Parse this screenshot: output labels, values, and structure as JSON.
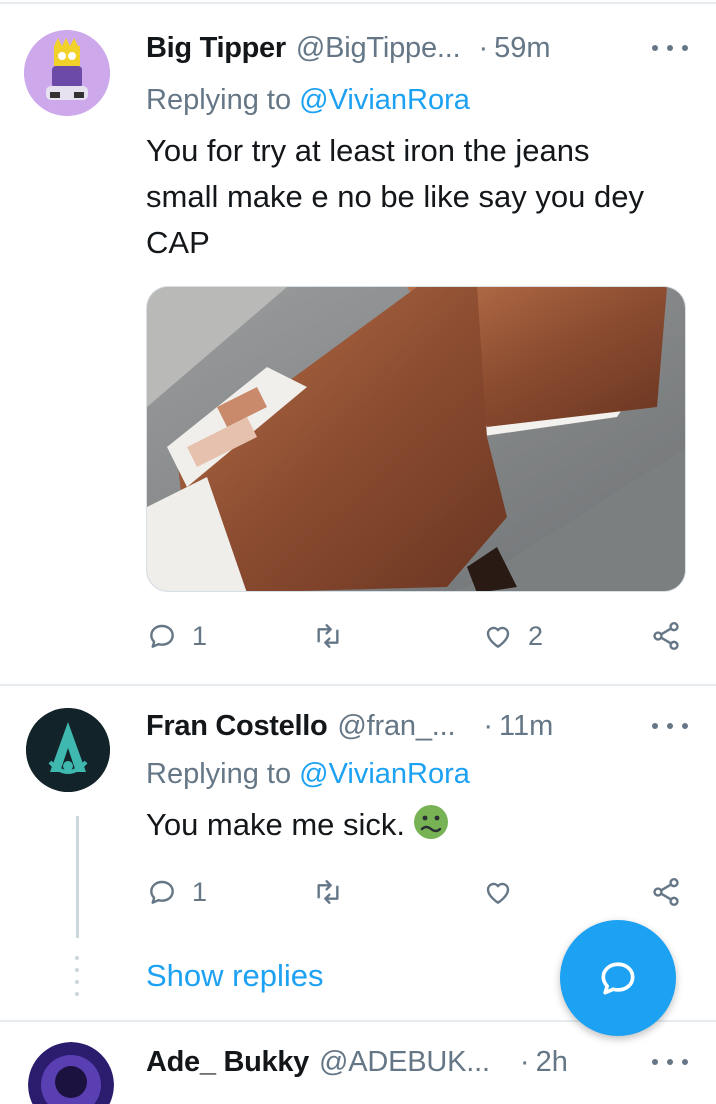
{
  "tweets": [
    {
      "name": "Big Tipper",
      "handle": "@BigTippe...",
      "separator": "·",
      "time": "59m",
      "replying_prefix": "Replying to",
      "replying_to": "@VivianRora",
      "text": "You for try at least iron the jeans small make e no be like say you dey CAP",
      "actions": {
        "reply_count": "1",
        "retweet_count": "",
        "like_count": "2"
      }
    },
    {
      "name": "Fran Costello",
      "handle": "@fran_...",
      "separator": "·",
      "time": "11m",
      "replying_prefix": "Replying to",
      "replying_to": "@VivianRora",
      "text": "You make me sick.",
      "actions": {
        "reply_count": "1",
        "retweet_count": "",
        "like_count": ""
      },
      "show_replies": "Show replies"
    },
    {
      "name": "Ade_ Bukky",
      "handle": "@ADEBUK...",
      "separator": "·",
      "time": "2h"
    }
  ],
  "icons": {
    "reply": "reply-icon",
    "retweet": "retweet-icon",
    "like": "like-icon",
    "share": "share-icon",
    "more": "more-icon",
    "compose": "compose-reply-icon",
    "emoji": "nauseated-face-emoji"
  },
  "colors": {
    "accent": "#1da1f2",
    "secondary_text": "#657786",
    "primary_text": "#14171a",
    "divider": "#e6ecf0"
  }
}
